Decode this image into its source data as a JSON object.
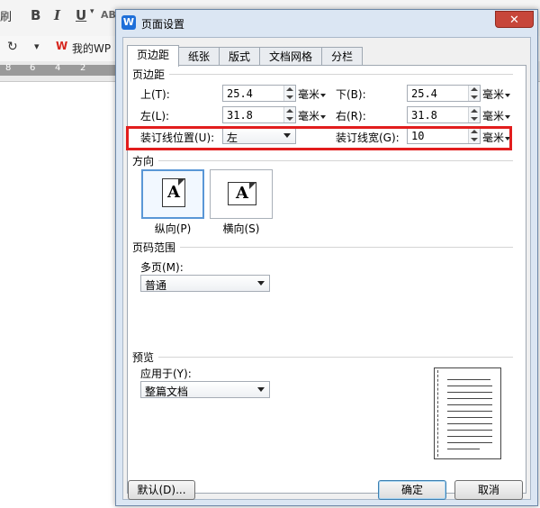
{
  "background": {
    "toolbar_label_left": "刷",
    "bold_label": "B",
    "italic_label": "I",
    "underline_label": "U",
    "font_color_label": "AB",
    "app_tab_label": "我的WP",
    "ruler_ticks": [
      "8",
      "6",
      "4",
      "2"
    ]
  },
  "dialog": {
    "title": "页面设置",
    "close_label": "✕",
    "tabs": [
      {
        "label": "页边距",
        "active": true
      },
      {
        "label": "纸张",
        "active": false
      },
      {
        "label": "版式",
        "active": false
      },
      {
        "label": "文档网格",
        "active": false
      },
      {
        "label": "分栏",
        "active": false
      }
    ],
    "margins": {
      "group_title": "页边距",
      "top_label": "上(T):",
      "top_value": "25.4",
      "bottom_label": "下(B):",
      "bottom_value": "25.4",
      "left_label": "左(L):",
      "left_value": "31.8",
      "right_label": "右(R):",
      "right_value": "31.8",
      "unit": "毫米",
      "gutter_pos_label": "装订线位置(U):",
      "gutter_pos_value": "左",
      "gutter_width_label": "装订线宽(G):",
      "gutter_width_value": "10"
    },
    "orientation": {
      "group_title": "方向",
      "portrait_label": "纵向(P)",
      "landscape_label": "横向(S)",
      "icon_letter": "A"
    },
    "page_range": {
      "group_title": "页码范围",
      "multi_label": "多页(M):",
      "multi_value": "普通"
    },
    "preview": {
      "group_title": "预览",
      "apply_label": "应用于(Y):",
      "apply_value": "整篇文档"
    },
    "buttons": {
      "default_label": "默认(D)...",
      "ok_label": "确定",
      "cancel_label": "取消"
    }
  },
  "colors": {
    "highlight": "#e21d1d",
    "selected_orientation": "#5a97d6",
    "close_button": "#c7463a"
  }
}
